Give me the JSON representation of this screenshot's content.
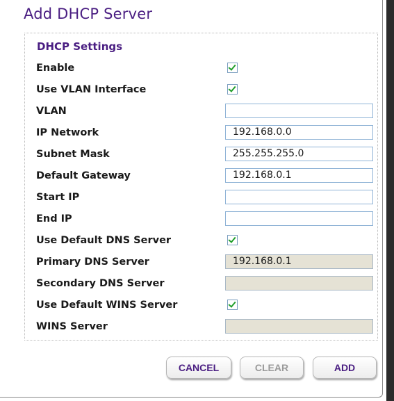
{
  "dialog": {
    "title": "Add DHCP Server"
  },
  "section": {
    "title": "DHCP Settings"
  },
  "fields": {
    "enable": {
      "label": "Enable",
      "checked": true
    },
    "use_vlan_interface": {
      "label": "Use VLAN Interface",
      "checked": true
    },
    "vlan": {
      "label": "VLAN",
      "value": ""
    },
    "ip_network": {
      "label": "IP Network",
      "value": "192.168.0.0"
    },
    "subnet_mask": {
      "label": "Subnet Mask",
      "value": "255.255.255.0"
    },
    "default_gateway": {
      "label": "Default Gateway",
      "value": "192.168.0.1"
    },
    "start_ip": {
      "label": "Start IP",
      "value": ""
    },
    "end_ip": {
      "label": "End IP",
      "value": ""
    },
    "use_default_dns": {
      "label": "Use Default DNS Server",
      "checked": true
    },
    "primary_dns": {
      "label": "Primary DNS Server",
      "value": "192.168.0.1",
      "disabled": true
    },
    "secondary_dns": {
      "label": "Secondary DNS Server",
      "value": "",
      "disabled": true
    },
    "use_default_wins": {
      "label": "Use Default WINS Server",
      "checked": true
    },
    "wins_server": {
      "label": "WINS Server",
      "value": "",
      "disabled": true
    }
  },
  "buttons": {
    "cancel": "CANCEL",
    "clear": "CLEAR",
    "add": "ADD"
  },
  "colors": {
    "title": "#4a1e82",
    "checkmark": "#1f9e2a",
    "disabled_field": "#e5e2d5"
  }
}
